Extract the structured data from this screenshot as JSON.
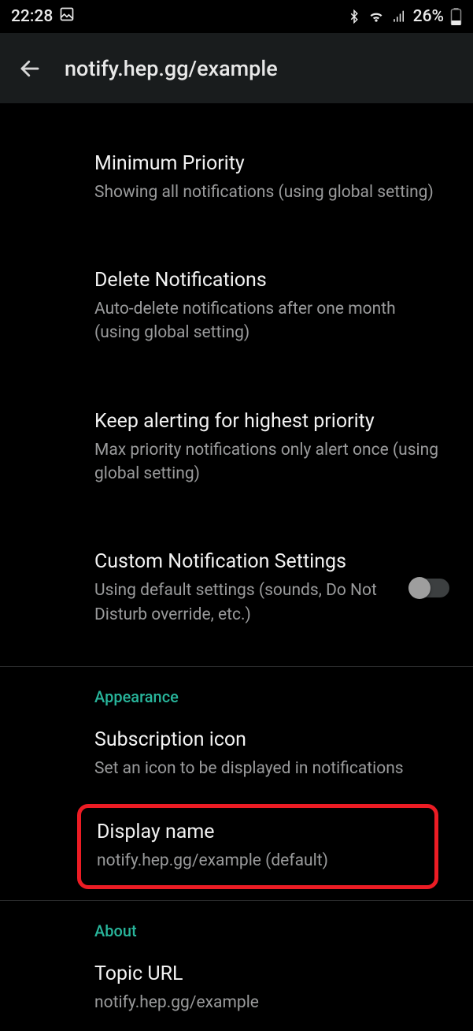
{
  "status": {
    "time": "22:28",
    "battery_pct": "26%"
  },
  "appbar": {
    "title": "notify.hep.gg/example"
  },
  "settings": {
    "min_priority": {
      "title": "Minimum Priority",
      "subtitle": "Showing all notifications (using global setting)"
    },
    "delete_notifs": {
      "title": "Delete Notifications",
      "subtitle": "Auto-delete notifications after one month (using global setting)"
    },
    "keep_alerting": {
      "title": "Keep alerting for highest priority",
      "subtitle": "Max priority notifications only alert once (using global setting)"
    },
    "custom_notif": {
      "title": "Custom Notification Settings",
      "subtitle": "Using default settings (sounds, Do Not Disturb override, etc.)",
      "enabled": false
    }
  },
  "sections": {
    "appearance": "Appearance",
    "about": "About"
  },
  "appearance": {
    "icon": {
      "title": "Subscription icon",
      "subtitle": "Set an icon to be displayed in notifications"
    },
    "display_name": {
      "title": "Display name",
      "subtitle": "notify.hep.gg/example (default)"
    }
  },
  "about": {
    "topic_url": {
      "title": "Topic URL",
      "subtitle": "notify.hep.gg/example"
    }
  }
}
